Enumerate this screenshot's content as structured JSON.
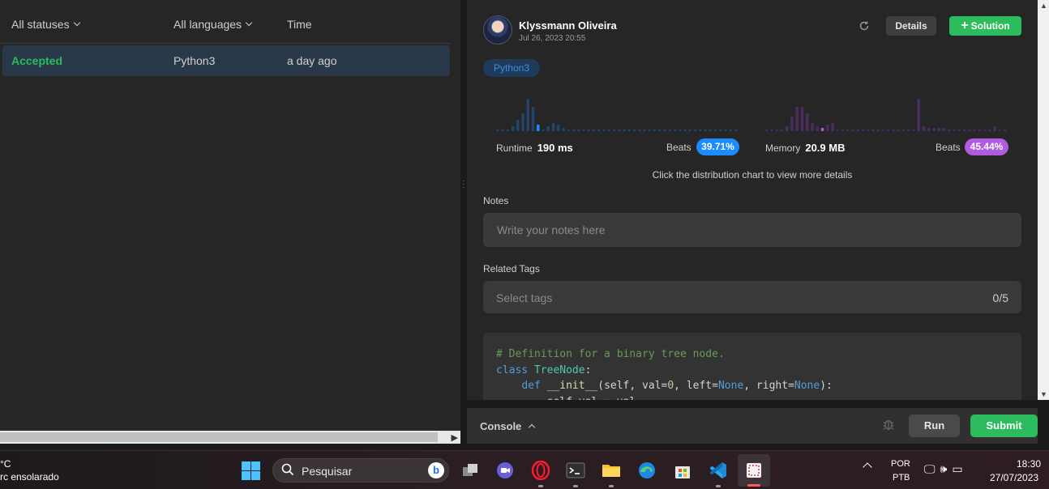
{
  "submissions": {
    "filters": {
      "status": "All statuses",
      "language": "All languages",
      "time": "Time"
    },
    "rows": [
      {
        "status": "Accepted",
        "language": "Python3",
        "time": "a day ago"
      }
    ]
  },
  "detail": {
    "author": "Klyssmann Oliveira",
    "date": "Jul 26, 2023 20:55",
    "details_label": "Details",
    "solution_label": "Solution",
    "language_tag": "Python3",
    "runtime": {
      "label": "Runtime",
      "value": "190 ms",
      "beats_label": "Beats",
      "beats": "39.71%"
    },
    "memory": {
      "label": "Memory",
      "value": "20.9 MB",
      "beats_label": "Beats",
      "beats": "45.44%"
    },
    "hint": "Click the distribution chart to view more details",
    "notes": {
      "label": "Notes",
      "placeholder": "Write your notes here"
    },
    "tags": {
      "label": "Related Tags",
      "placeholder": "Select tags",
      "count": "0/5"
    },
    "code_lines": [
      "# Definition for a binary tree node.",
      "class TreeNode:",
      "    def __init__(self, val=0, left=None, right=None):",
      "        self.val = val"
    ]
  },
  "console": {
    "label": "Console",
    "run_label": "Run",
    "submit_label": "Submit"
  },
  "taskbar": {
    "weather_temp": "°C",
    "weather_desc": "rc ensolarado",
    "search_placeholder": "Pesquisar",
    "lang_top": "POR",
    "lang_bottom": "PTB",
    "time": "18:30",
    "date": "27/07/2023"
  },
  "colors": {
    "accent_green": "#2cbb5d",
    "runtime_blue": "#1a8cff",
    "memory_purple": "#b05ce0"
  }
}
